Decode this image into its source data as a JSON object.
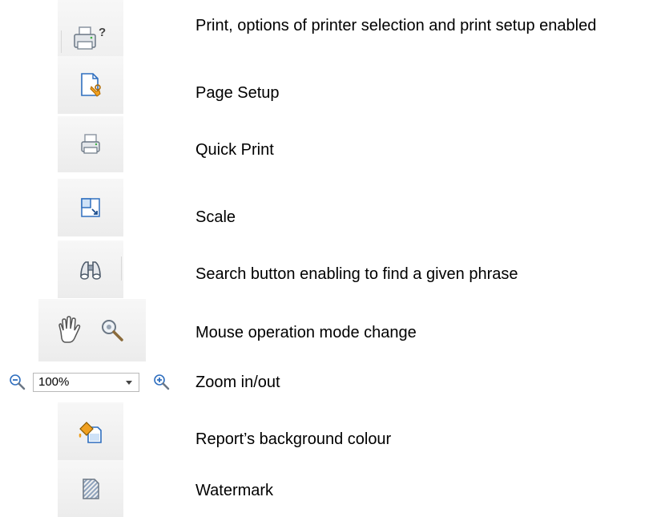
{
  "items": [
    {
      "icon": "print-dialog-icon",
      "label": "Print, options of printer selection and print setup enabled"
    },
    {
      "icon": "page-setup-icon",
      "label": "Page Setup"
    },
    {
      "icon": "quick-print-icon",
      "label": "Quick Print"
    },
    {
      "icon": "scale-icon",
      "label": "Scale"
    },
    {
      "icon": "binoculars-search-icon",
      "label": "Search button enabling to find a given phrase"
    },
    {
      "icon": "hand-and-magnifier-icons",
      "label": "Mouse operation mode change"
    },
    {
      "icon": "zoom-controls",
      "label": "Zoom in/out"
    },
    {
      "icon": "background-color-icon",
      "label": "Report’s background colour"
    },
    {
      "icon": "watermark-icon",
      "label": "Watermark"
    }
  ],
  "zoom": {
    "value": "100%"
  },
  "colors": {
    "icon_blue": "#2f6fbf",
    "icon_gray": "#6b7785",
    "accent_orange": "#f0a020"
  }
}
